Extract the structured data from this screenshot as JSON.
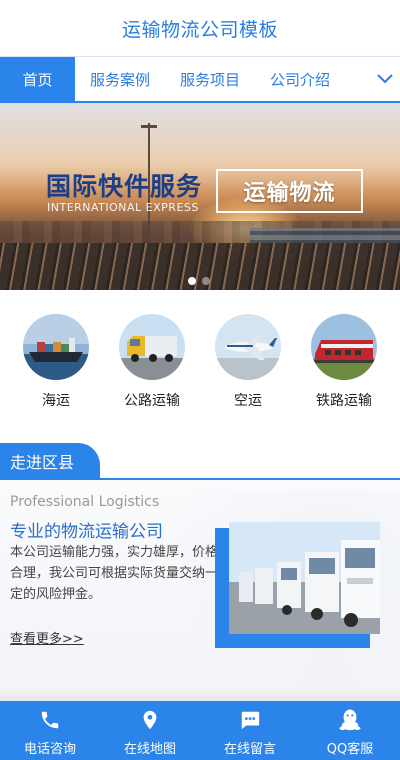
{
  "header": {
    "title": "运输物流公司模板"
  },
  "nav": {
    "items": [
      {
        "label": "首页",
        "active": true
      },
      {
        "label": "服务案例",
        "active": false
      },
      {
        "label": "服务项目",
        "active": false
      },
      {
        "label": "公司介绍",
        "active": false
      }
    ],
    "expand_icon": "chevron-down-icon"
  },
  "banner": {
    "title_cn": "国际快件服务",
    "title_en": "INTERNATIONAL EXPRESS",
    "boxed_text": "运输物流",
    "slides_total": 2,
    "active_slide": 1
  },
  "services": [
    {
      "label": "海运",
      "image": "container-ship"
    },
    {
      "label": "公路运输",
      "image": "truck"
    },
    {
      "label": "空运",
      "image": "airplane"
    },
    {
      "label": "铁路运输",
      "image": "train"
    }
  ],
  "section": {
    "title": "走进区县"
  },
  "about": {
    "subtitle_en": "Professional Logistics",
    "title_cn": "专业的物流运输公司",
    "description": "本公司运输能力强，实力雄厚，价格合理，我公司可根据实际货量交纳一定的风险押金。",
    "more_link": "查看更多>>",
    "image": "truck-fleet"
  },
  "bottom_bar": [
    {
      "label": "电话咨询",
      "icon": "phone-icon"
    },
    {
      "label": "在线地图",
      "icon": "map-pin-icon"
    },
    {
      "label": "在线留言",
      "icon": "message-icon"
    },
    {
      "label": "QQ客服",
      "icon": "qq-icon"
    }
  ],
  "colors": {
    "primary": "#2b84ea",
    "title_blue": "#2b7de0",
    "banner_title": "#1a3f86",
    "text_dark": "#222222"
  }
}
